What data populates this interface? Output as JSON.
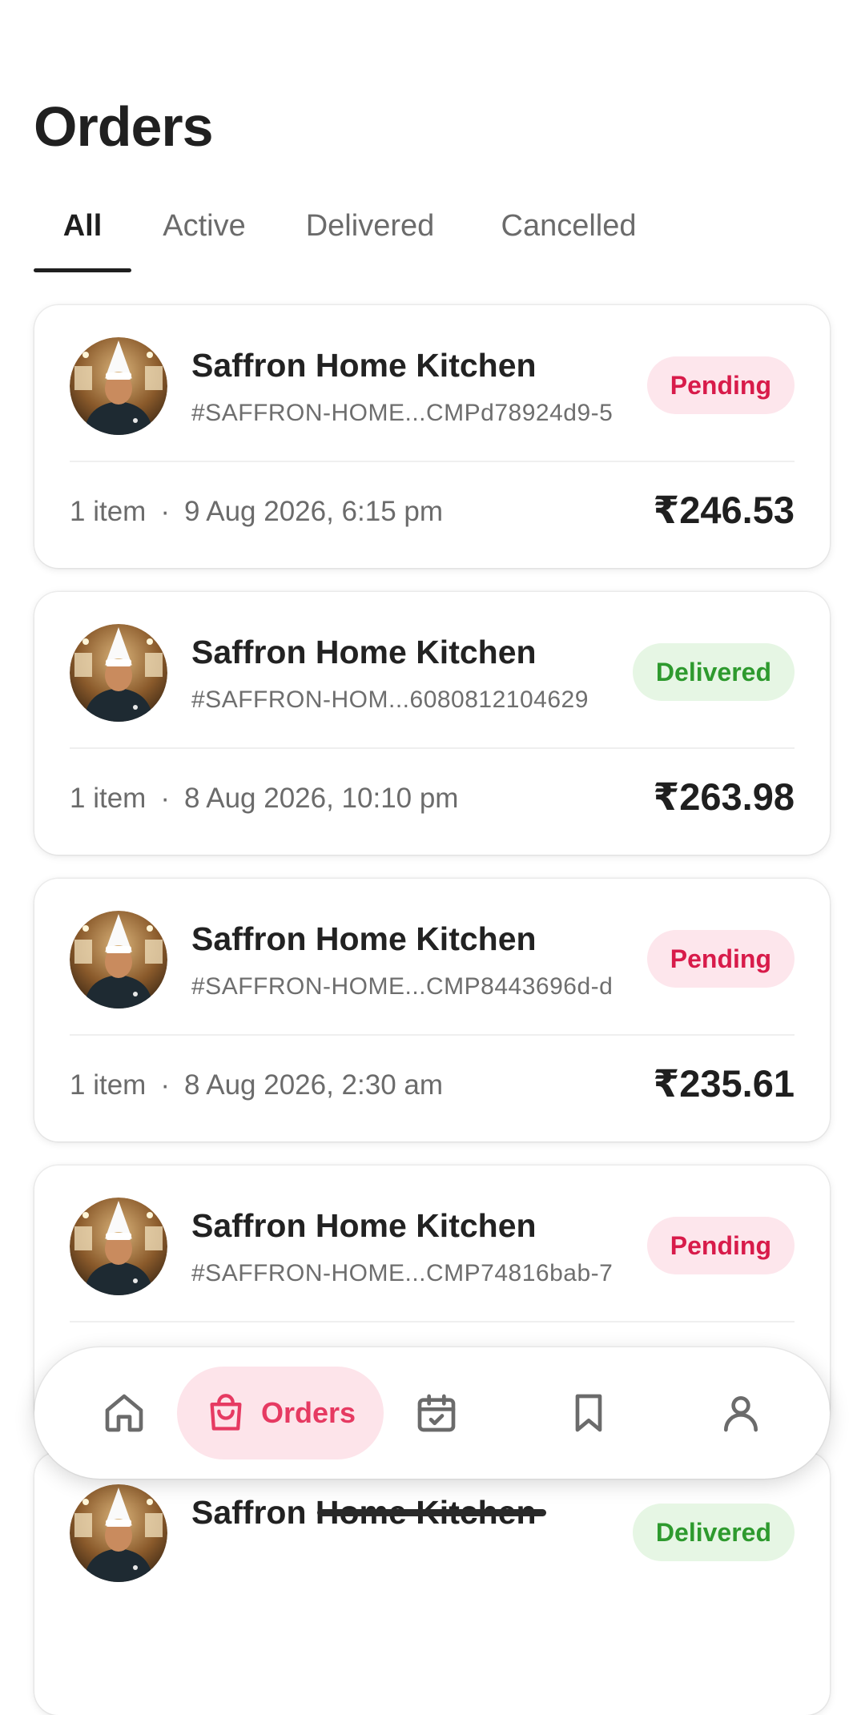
{
  "page": {
    "title": "Orders"
  },
  "tabs": [
    {
      "label": "All",
      "active": true
    },
    {
      "label": "Active",
      "active": false
    },
    {
      "label": "Delivered",
      "active": false
    },
    {
      "label": "Cancelled",
      "active": false
    }
  ],
  "orders": [
    {
      "kitchen": "Saffron Home Kitchen",
      "order_id": "#SAFFRON-HOME...CMPd78924d9-5",
      "status": "Pending",
      "status_type": "pending",
      "items": "1 item",
      "date": "9 Aug 2026, 6:15 pm",
      "total": "₹246.53"
    },
    {
      "kitchen": "Saffron Home Kitchen",
      "order_id": "#SAFFRON-HOM...6080812104629",
      "status": "Delivered",
      "status_type": "delivered",
      "items": "1 item",
      "date": "8 Aug 2026, 10:10 pm",
      "total": "₹263.98"
    },
    {
      "kitchen": "Saffron Home Kitchen",
      "order_id": "#SAFFRON-HOME...CMP8443696d-d",
      "status": "Pending",
      "status_type": "pending",
      "items": "1 item",
      "date": "8 Aug 2026, 2:30 am",
      "total": "₹235.61"
    },
    {
      "kitchen": "Saffron Home Kitchen",
      "order_id": "#SAFFRON-HOME...CMP74816bab-7",
      "status": "Pending",
      "status_type": "pending",
      "items": "",
      "date": "",
      "total": ""
    },
    {
      "kitchen": "Saffron Home Kitchen",
      "order_id": "",
      "status": "Delivered",
      "status_type": "delivered",
      "items": "",
      "date": "",
      "total": ""
    }
  ],
  "status_colors": {
    "pending": {
      "text": "#d81b4a",
      "bg": "#fde6ec"
    },
    "delivered": {
      "text": "#2e9a2e",
      "bg": "#e6f6e4"
    }
  },
  "bottom_nav": {
    "items": [
      {
        "icon": "home-icon",
        "label": ""
      },
      {
        "icon": "shopping-bag-icon",
        "label": "Orders",
        "active": true
      },
      {
        "icon": "calendar-check-icon",
        "label": ""
      },
      {
        "icon": "bookmark-icon",
        "label": ""
      },
      {
        "icon": "user-icon",
        "label": ""
      }
    ],
    "accent": "#e63a62"
  }
}
